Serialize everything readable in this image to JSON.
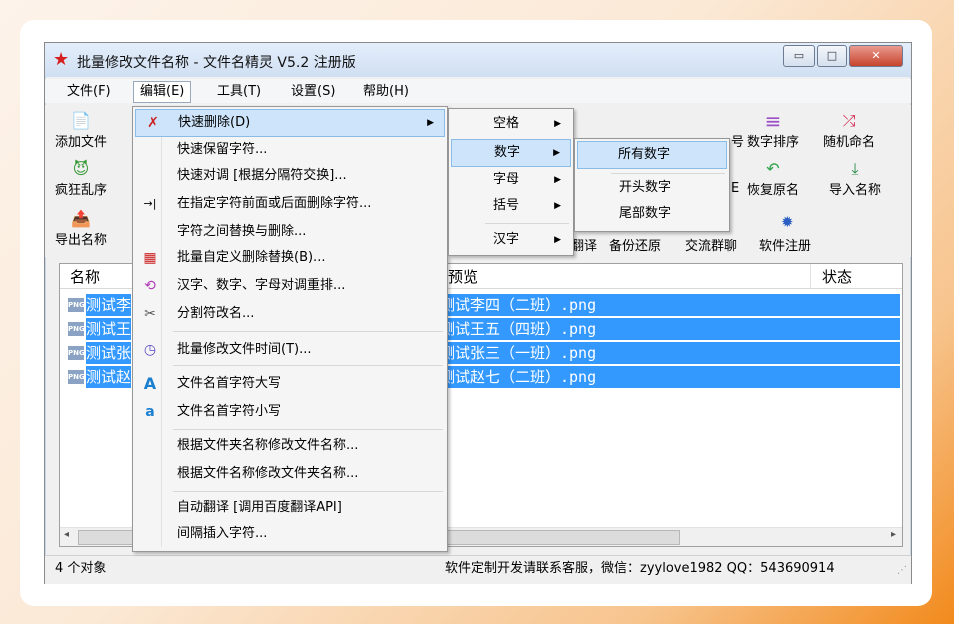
{
  "window": {
    "title": "批量修改文件名称 - 文件名精灵 V5.2 注册版",
    "app_icon": "star-icon",
    "buttons": {
      "minimize": "▭",
      "maximize": "□",
      "close": "✕"
    }
  },
  "menubar": [
    {
      "label": "文件(F)"
    },
    {
      "label": "编辑(E)"
    },
    {
      "label": "工具(T)"
    },
    {
      "label": "设置(S)"
    },
    {
      "label": "帮助(H)"
    }
  ],
  "toolbar": {
    "left": [
      {
        "label": "添加文件",
        "icon": "add-file-icon",
        "glyph": "📄"
      },
      {
        "label": "疯狂乱序",
        "icon": "crazy-face-icon",
        "glyph": "😈"
      },
      {
        "label": "导出名称",
        "icon": "export-icon",
        "glyph": "📤"
      }
    ],
    "right_row1": [
      {
        "label": "数字排序",
        "icon": "list-lines-icon",
        "glyph": "≡"
      },
      {
        "label": "随机命名",
        "icon": "shuffle-icon",
        "glyph": "⤮"
      }
    ],
    "right_row2": [
      {
        "label": "恢复原名",
        "icon": "undo-icon",
        "glyph": "↶"
      },
      {
        "label": "导入名称",
        "icon": "import-icon",
        "glyph": "⤓"
      }
    ],
    "bottom_row": [
      "翻译",
      "备份还原",
      "交流群聊",
      "软件注册"
    ],
    "partial_row1": "号",
    "partial_row2": "E",
    "gear_glyph": "✹"
  },
  "list": {
    "columns": {
      "name": "名称",
      "preview": "预览",
      "status": "状态"
    },
    "rows": [
      {
        "name": "测试李",
        "preview": "测试李四（二班）.png"
      },
      {
        "name": "测试王",
        "preview": "测试王五（四班）.png"
      },
      {
        "name": "测试张",
        "preview": "测试张三（一班）.png"
      },
      {
        "name": "测试赵",
        "preview": "测试赵七（二班）.png"
      }
    ]
  },
  "statusbar": {
    "count": "4 个对象",
    "contact": "软件定制开发请联系客服，微信：zyylove1982  QQ：543690914"
  },
  "edit_menu": [
    {
      "label": "快速删除(D)",
      "icon": "delete-x-icon",
      "glyph": "✗",
      "submenu": true
    },
    {
      "label": "快速保留字符..."
    },
    {
      "label": "快速对调 [根据分隔符交换]..."
    },
    {
      "label": "在指定字符前面或后面删除字符...",
      "icon": "arrow-bar-icon",
      "glyph": "→|"
    },
    {
      "label": "字符之间替换与删除..."
    },
    {
      "label": "批量自定义删除替换(B)...",
      "icon": "table-x-icon",
      "glyph": "▦"
    },
    {
      "label": "汉字、数字、字母对调重排...",
      "icon": "swap-icon",
      "glyph": "⟲"
    },
    {
      "label": "分割符改名...",
      "icon": "scissors-icon",
      "glyph": "✂"
    },
    {
      "label": "批量修改文件时间(T)...",
      "icon": "clock-icon",
      "glyph": "◷"
    },
    {
      "label": "文件名首字符大写",
      "icon": "uppercase-a-icon",
      "glyph": "A"
    },
    {
      "label": "文件名首字符小写",
      "icon": "lowercase-a-icon",
      "glyph": "a"
    },
    {
      "label": "根据文件夹名称修改文件名称..."
    },
    {
      "label": "根据文件名称修改文件夹名称..."
    },
    {
      "label": "自动翻译 [调用百度翻译API]"
    },
    {
      "label": "间隔插入字符..."
    }
  ],
  "delete_submenu": [
    {
      "label": "空格"
    },
    {
      "label": "数字"
    },
    {
      "label": "字母"
    },
    {
      "label": "括号"
    },
    {
      "label": "汉字"
    }
  ],
  "digits_submenu": [
    {
      "label": "所有数字"
    },
    {
      "label": "开头数字"
    },
    {
      "label": "尾部数字"
    }
  ],
  "colors": {
    "selection": "#3399ff",
    "menu_highlight": "#cde4fb",
    "accent": "#f28a1c"
  }
}
